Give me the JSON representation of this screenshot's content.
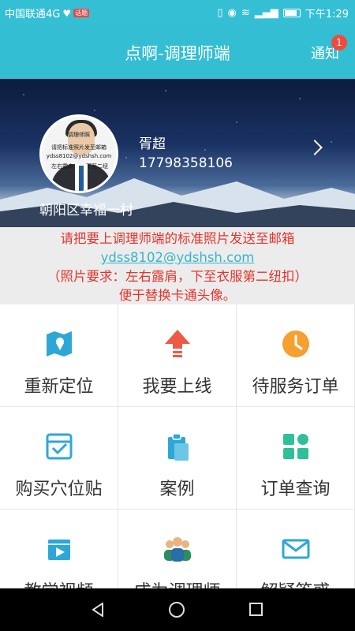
{
  "status_bar": {
    "carrier": "中国联通4G",
    "app_badge": "话题",
    "network": "4G",
    "time": "下午1:29"
  },
  "header": {
    "title": "点啊-调理师端",
    "notice_label": "通知",
    "notice_count": "1"
  },
  "profile": {
    "name": "胥超",
    "phone": "17798358106",
    "district": "朝阳区幸福一村",
    "avatar_watermark": {
      "line1": "调理师照",
      "line2": "请把标准照片发至邮箱",
      "line3": "ydss8102@ydshsh.com",
      "line4_left": "左右露肩",
      "line4_right": "下至二纽"
    }
  },
  "notice_panel": {
    "line1": "请把要上调理师端的标准照片发送至邮箱",
    "email": "ydss8102@ydshsh.com",
    "line3": "（照片要求：左右露肩，下至衣服第二纽扣）",
    "line4": "便于替换卡通头像。"
  },
  "menu": [
    {
      "label": "重新定位",
      "icon": "map-location-icon"
    },
    {
      "label": "我要上线",
      "icon": "upload-arrow-icon"
    },
    {
      "label": "待服务订单",
      "icon": "clock-icon"
    },
    {
      "label": "购买穴位贴",
      "icon": "inbox-check-icon"
    },
    {
      "label": "案例",
      "icon": "clipboard-icon"
    },
    {
      "label": "订单查询",
      "icon": "grid-blocks-icon"
    },
    {
      "label": "教学视频",
      "icon": "video-icon"
    },
    {
      "label": "成为调理师",
      "icon": "team-icon"
    },
    {
      "label": "解疑答惑",
      "icon": "mail-icon"
    }
  ],
  "colors": {
    "primary": "#33bed3",
    "alert_red": "#e5342c",
    "badge_red": "#f04b3c",
    "blue_icon": "#2fa7d6",
    "orange_icon": "#f5a031",
    "green_icon": "#2fbf9a"
  }
}
